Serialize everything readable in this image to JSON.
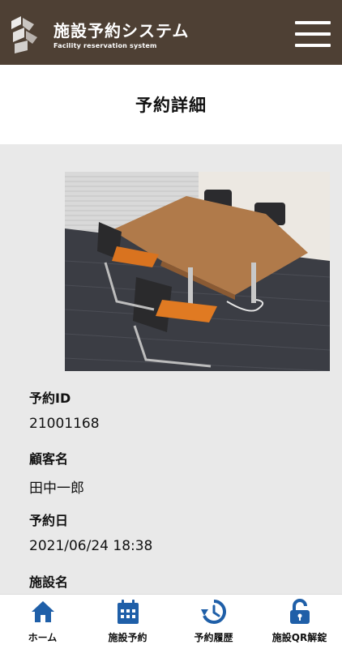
{
  "header": {
    "title": "施設予約システム",
    "subtitle": "Facility reservation system",
    "menu_icon": "hamburger-menu-icon",
    "bg_color": "#4e4034"
  },
  "page": {
    "title": "予約詳細"
  },
  "detail": {
    "image_subject": "meeting room photo",
    "fields": [
      {
        "label": "予約ID",
        "value": "21001168"
      },
      {
        "label": "顧客名",
        "value": "田中一郎"
      },
      {
        "label": "予約日",
        "value": "2021/06/24 18:38"
      },
      {
        "label": "施設名",
        "value": ""
      }
    ]
  },
  "tabbar": {
    "accent_color": "#1f5fa8",
    "tabs": [
      {
        "label": "ホーム",
        "icon": "home-icon"
      },
      {
        "label": "施設予約",
        "icon": "calendar-icon"
      },
      {
        "label": "予約履歴",
        "icon": "history-icon"
      },
      {
        "label": "施設QR解錠",
        "icon": "unlock-icon"
      }
    ]
  }
}
